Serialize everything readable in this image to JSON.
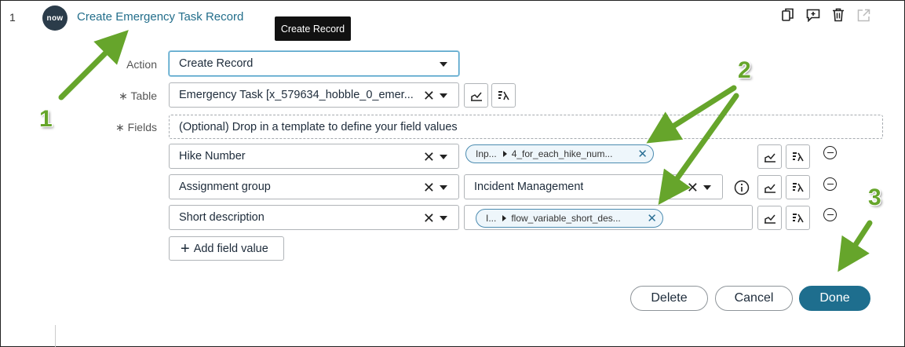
{
  "step": {
    "number": "1",
    "logo_text": "now",
    "title": "Create Emergency Task Record",
    "tooltip": "Create Record"
  },
  "toolbar_icons": [
    "copy-icon",
    "add-comment-icon",
    "trash-icon",
    "open-external-icon"
  ],
  "labels": {
    "action": "Action",
    "table": "Table",
    "fields": "Fields",
    "required_mark": "∗"
  },
  "action": {
    "value": "Create Record"
  },
  "table": {
    "value": "Emergency Task [x_579634_hobble_0_emer..."
  },
  "dropzone": {
    "text": "(Optional) Drop in a template to define your field values"
  },
  "field_rows": [
    {
      "field": "Hike Number",
      "pill_short": "Inp...",
      "pill_value": "4_for_each_hike_num..."
    },
    {
      "field": "Assignment group",
      "value": "Incident Management"
    },
    {
      "field": "Short description",
      "pill_short": "I...",
      "pill_value": "flow_variable_short_des..."
    }
  ],
  "add_field": {
    "label": "Add field value"
  },
  "buttons": {
    "delete": "Delete",
    "cancel": "Cancel",
    "done": "Done"
  },
  "annotations": [
    "1",
    "2",
    "3"
  ],
  "colors": {
    "accent": "#1e6e8e",
    "annotation": "#66a52b",
    "link": "#236e8b"
  }
}
